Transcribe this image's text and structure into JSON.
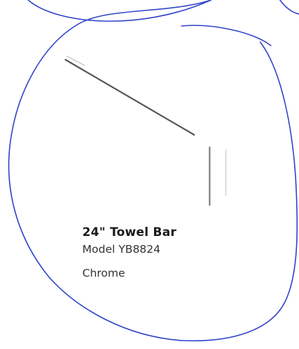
{
  "product": {
    "title": "24\" Towel Bar",
    "model": "Model YB8824",
    "finish": "Chrome"
  },
  "colors": {
    "pen_ink": "#2f44c9",
    "product_line": "#555555",
    "text": "#222222"
  }
}
